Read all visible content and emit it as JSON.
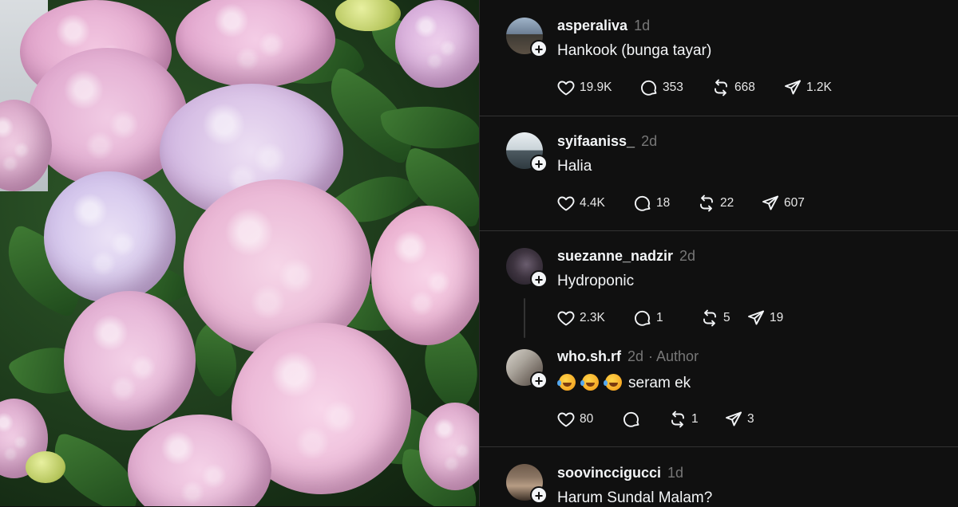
{
  "comments": [
    {
      "username": "asperaliva",
      "time": "1d",
      "text": "Hankook (bunga tayar)",
      "likes": "19.9K",
      "replies": "353",
      "reposts": "668",
      "shares": "1.2K"
    },
    {
      "username": "syifaaniss_",
      "time": "2d",
      "text": "Halia",
      "likes": "4.4K",
      "replies": "18",
      "reposts": "22",
      "shares": "607"
    },
    {
      "username": "suezanne_nadzir",
      "time": "2d",
      "text": "Hydroponic",
      "likes": "2.3K",
      "replies": "1",
      "reposts": "5",
      "shares": "19"
    },
    {
      "username": "who.sh.rf",
      "time": "2d",
      "author_tag": "· Author",
      "emoji": "🤣🤣🤣",
      "text": "seram ek",
      "likes": "80",
      "replies": "",
      "reposts": "1",
      "shares": "3"
    },
    {
      "username": "soovinccigucci",
      "time": "1d",
      "text": "Harum Sundal Malam?"
    }
  ],
  "icons": {
    "like": "heart-icon",
    "reply": "comment-bubble-icon",
    "repost": "repost-icon",
    "share": "send-icon",
    "follow": "plus-icon"
  },
  "colors": {
    "background": "#101010",
    "text": "#f3f5f7",
    "muted": "#777777",
    "divider": "#323232"
  }
}
